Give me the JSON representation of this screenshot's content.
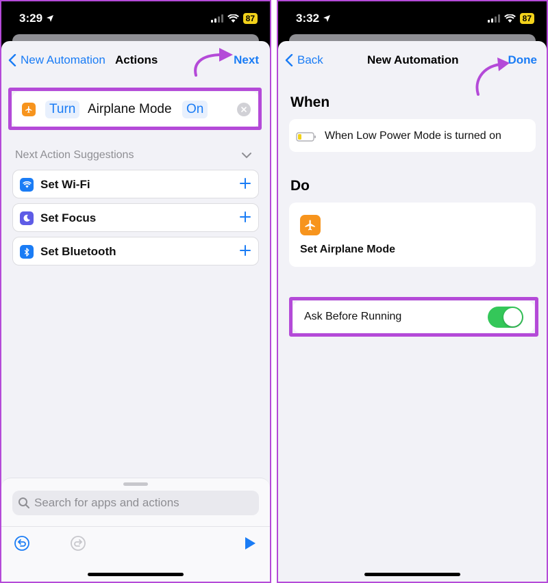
{
  "left": {
    "status": {
      "time": "3:29",
      "battery": "87"
    },
    "nav": {
      "back_label": "New Automation",
      "title": "Actions",
      "action_label": "Next"
    },
    "action": {
      "verb": "Turn",
      "target": "Airplane Mode",
      "state": "On"
    },
    "suggestions": {
      "heading": "Next Action Suggestions",
      "items": [
        {
          "label": "Set Wi-Fi",
          "icon": "wifi-icon",
          "color": "#1a7cf5"
        },
        {
          "label": "Set Focus",
          "icon": "moon-icon",
          "color": "#5e5ce6"
        },
        {
          "label": "Set Bluetooth",
          "icon": "bluetooth-icon",
          "color": "#1a7cf5"
        }
      ]
    },
    "search": {
      "placeholder": "Search for apps and actions"
    }
  },
  "right": {
    "status": {
      "time": "3:32",
      "battery": "87"
    },
    "nav": {
      "back_label": "Back",
      "title": "New Automation",
      "action_label": "Done"
    },
    "when": {
      "heading": "When",
      "trigger": "When Low Power Mode is turned on"
    },
    "do": {
      "heading": "Do",
      "action": "Set Airplane Mode"
    },
    "ask": {
      "label": "Ask Before Running",
      "enabled": true
    }
  },
  "colors": {
    "accent": "#1a7cf5",
    "highlight": "#b44ad8",
    "toggle_on": "#34c759",
    "airplane": "#f7941d"
  }
}
